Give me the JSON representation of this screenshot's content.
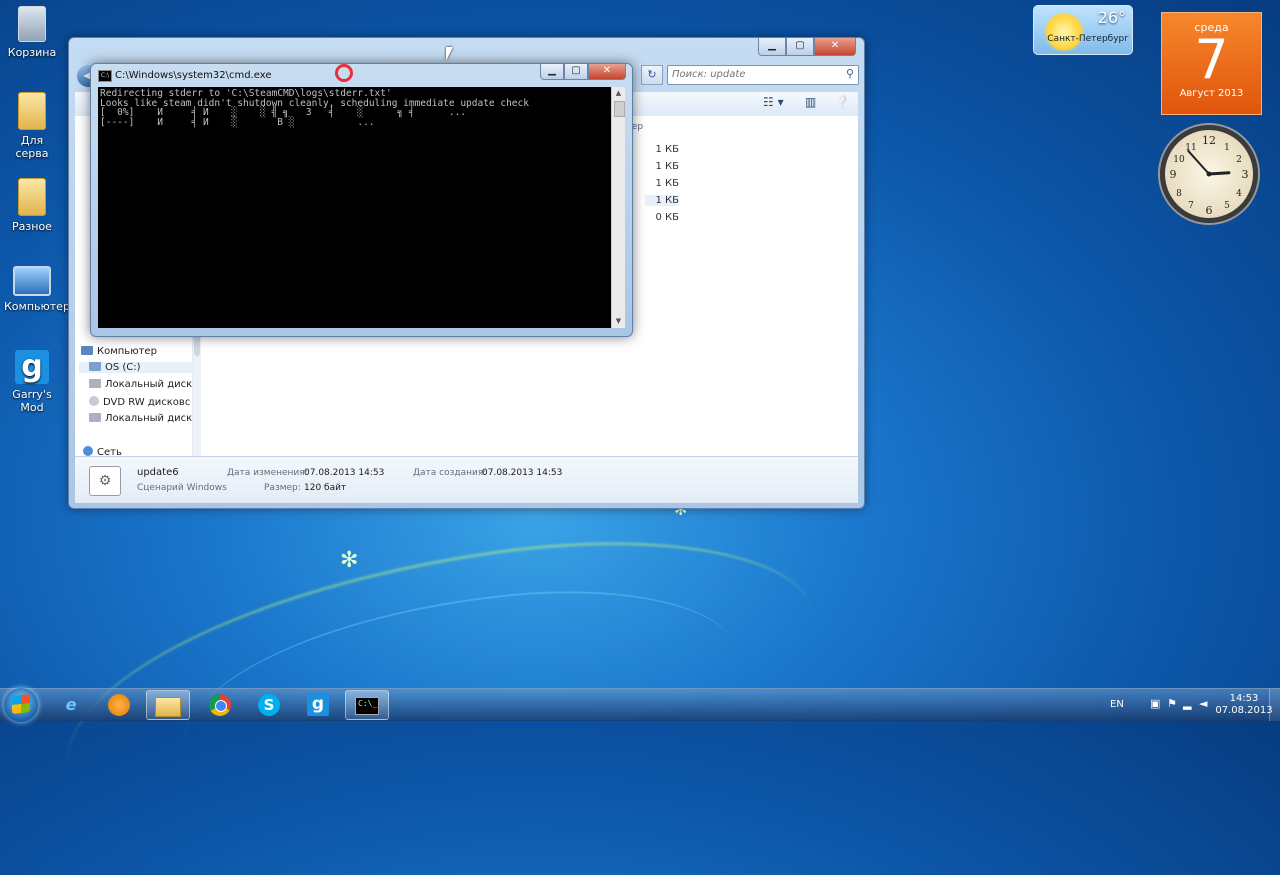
{
  "desktop": {
    "icons": [
      {
        "label": "Корзина",
        "icon": "recycle-bin-icon"
      },
      {
        "label": "Для серва",
        "icon": "folder-icon"
      },
      {
        "label": "Разное",
        "icon": "folder-icon"
      },
      {
        "label": "Компьютер",
        "icon": "computer-icon"
      },
      {
        "label": "Garry's Mod",
        "icon": "gmod-icon"
      }
    ]
  },
  "gadgets": {
    "weather": {
      "temp": "26°",
      "city": "Санкт-Петербург"
    },
    "calendar": {
      "weekday": "среда",
      "day": "7",
      "month_year": "Август 2013"
    },
    "clock": {
      "hour": 14,
      "minute": 53
    }
  },
  "explorer": {
    "search_placeholder": "Поиск: update",
    "nav_items": {
      "computer": "Компьютер",
      "os_c": "OS (C:)",
      "local_disk_1": "Локальный диск",
      "dvd": "DVD RW дисковс",
      "local_disk_2": "Локальный диск",
      "network": "Сеть"
    },
    "column_header_size": "мер",
    "file_sizes": [
      "1 КБ",
      "1 КБ",
      "1 КБ",
      "1 КБ",
      "0 КБ"
    ],
    "details": {
      "name": "update6",
      "type": "Сценарий Windows",
      "modified_label": "Дата изменения:",
      "modified_value": "07.08.2013 14:53",
      "created_label": "Дата создания:",
      "created_value": "07.08.2013 14:53",
      "size_label": "Размер:",
      "size_value": "120 байт"
    }
  },
  "cmd": {
    "title": "C:\\Windows\\system32\\cmd.exe",
    "output": "Redirecting stderr to 'C:\\SteamCMD\\logs\\stderr.txt'\nLooks like steam didn't shutdown cleanly, scheduling immediate update check\n[  0%]    И     ╡ И    ░    ░ ╣ ╗   3   ╡    ░      ╗ ╡      ...\n[----]    И     ╡ И    ░       В ░           ..."
  },
  "taskbar": {
    "apps": [
      "internet-explorer-icon",
      "media-player-icon",
      "explorer-folder-icon",
      "chrome-icon",
      "skype-icon",
      "gmod-icon",
      "cmd-icon"
    ],
    "lang": "EN",
    "time": "14:53",
    "date": "07.08.2013"
  }
}
